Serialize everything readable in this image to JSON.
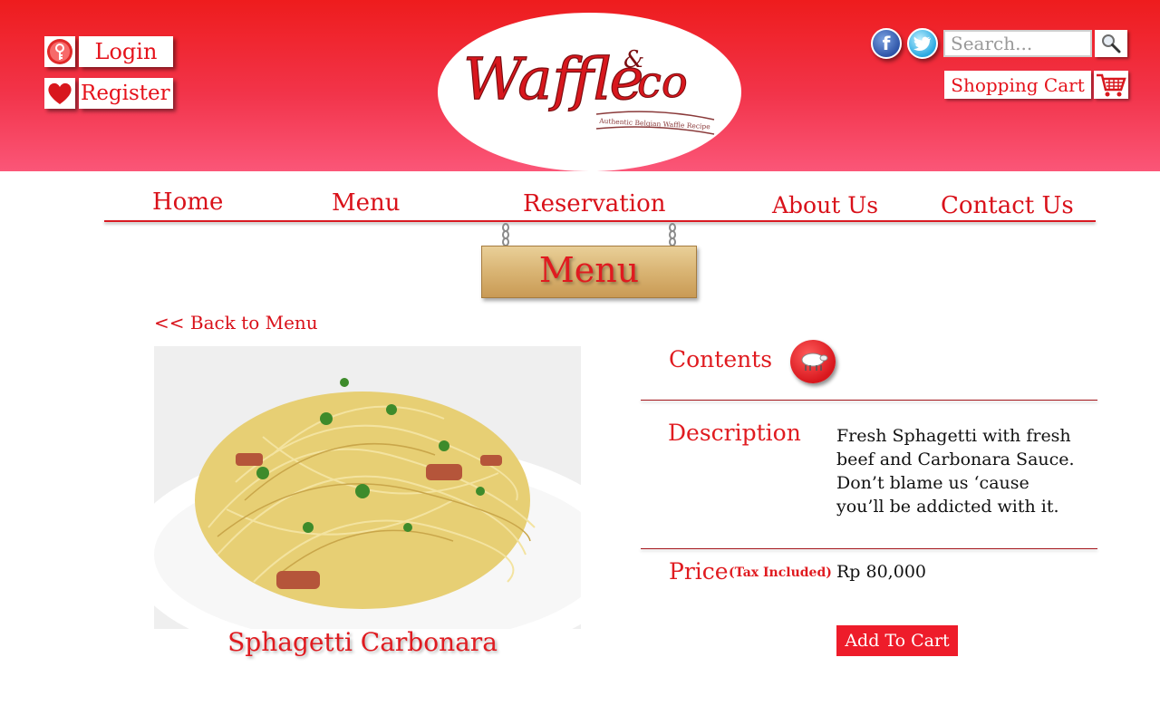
{
  "header": {
    "login_label": "Login",
    "register_label": "Register",
    "logo": {
      "brand": "Waffle&co",
      "tagline": "Authentic Belgian Waffle Recipe"
    },
    "search_placeholder": "Search...",
    "cart_label": "Shopping Cart"
  },
  "nav": {
    "items": [
      {
        "label": "Home"
      },
      {
        "label": "Menu"
      },
      {
        "label": "Reservation"
      },
      {
        "label": "About Us"
      },
      {
        "label": "Contact Us"
      }
    ]
  },
  "section_title": "Menu",
  "product": {
    "back_link": "<< Back to Menu",
    "name": "Sphagetti Carbonara",
    "contents_label": "Contents",
    "description_label": "Description",
    "description": "Fresh Sphagetti with fresh beef and Carbonara Sauce. Don’t blame us ‘cause you’ll be addicted with it.",
    "price_label": "Price",
    "price_note": "(Tax Included)",
    "price": "Rp 80,000",
    "add_to_cart": "Add To Cart"
  },
  "colors": {
    "brand_red": "#e01b20",
    "header_top": "#ee1c1d",
    "header_bottom": "#fb5678"
  }
}
